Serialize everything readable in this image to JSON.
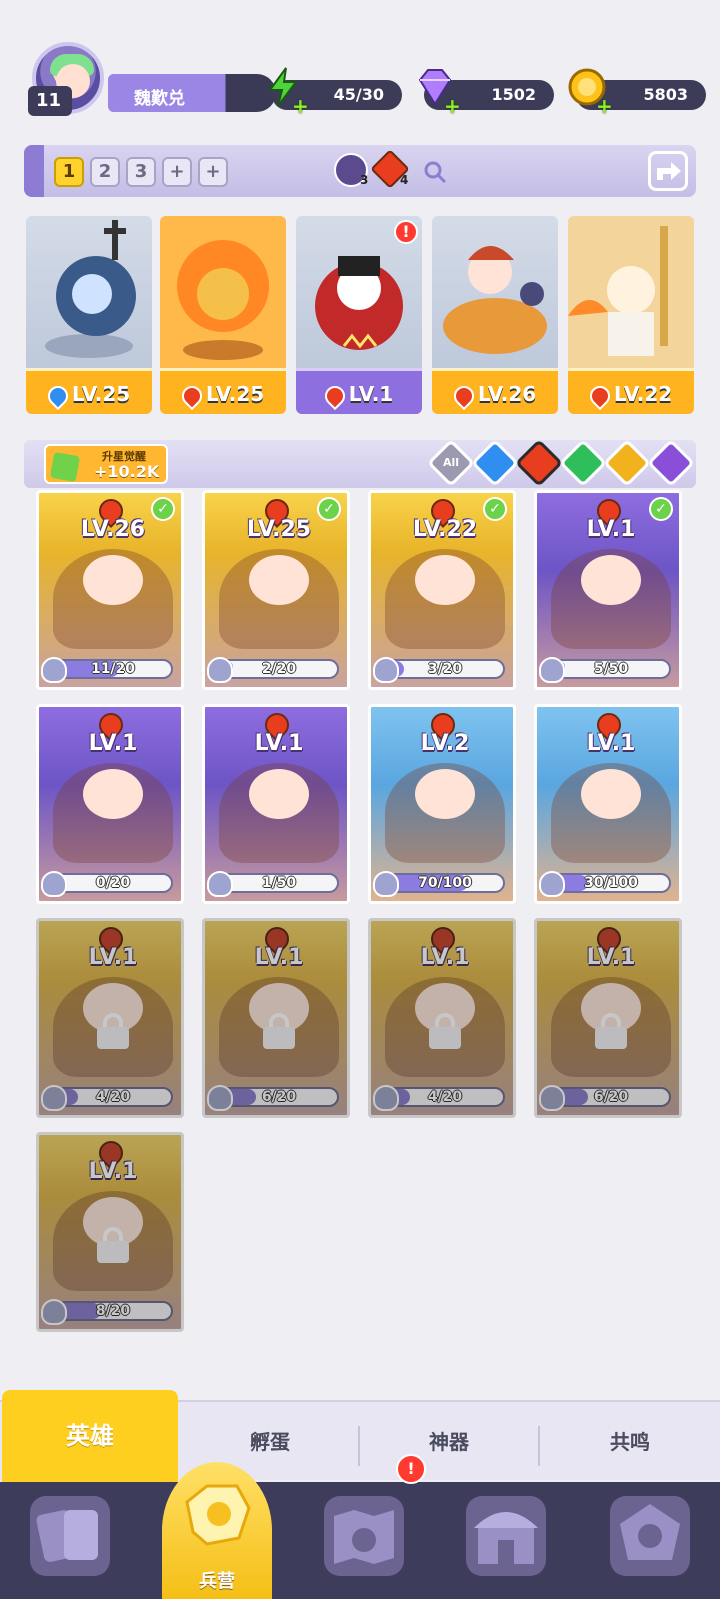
{
  "profile": {
    "level": "11",
    "name": "魏歎兑"
  },
  "resources": {
    "energy": "45/30",
    "gems": "1502",
    "coins": "5803"
  },
  "team": {
    "slots": [
      "1",
      "2",
      "3",
      "+",
      "+"
    ],
    "active_slot": "1",
    "counts": {
      "dark": "3",
      "fire": "4"
    },
    "members": [
      {
        "level": "LV.25",
        "element": "water"
      },
      {
        "level": "LV.25",
        "element": "fire"
      },
      {
        "level": "LV.1",
        "element": "fire",
        "alert": "!"
      },
      {
        "level": "LV.26",
        "element": "fire"
      },
      {
        "level": "LV.22",
        "element": "fire"
      }
    ]
  },
  "filter": {
    "upstar_label": "升星觉醒",
    "upstar_value": "+10.2K",
    "options": [
      "All",
      "water",
      "fire",
      "wind",
      "light",
      "dark"
    ]
  },
  "heroes": [
    {
      "level": "LV.26",
      "progress": "11/20",
      "ratio": 0.55,
      "style": "gold",
      "checked": true,
      "locked": false
    },
    {
      "level": "LV.25",
      "progress": "2/20",
      "ratio": 0.1,
      "style": "gold",
      "checked": true,
      "locked": false
    },
    {
      "level": "LV.22",
      "progress": "3/20",
      "ratio": 0.15,
      "style": "gold",
      "checked": true,
      "locked": false
    },
    {
      "level": "LV.1",
      "progress": "5/50",
      "ratio": 0.1,
      "style": "purple",
      "checked": true,
      "locked": false
    },
    {
      "level": "LV.1",
      "progress": "0/20",
      "ratio": 0,
      "style": "purple",
      "checked": false,
      "locked": false
    },
    {
      "level": "LV.1",
      "progress": "1/50",
      "ratio": 0.02,
      "style": "purple",
      "checked": false,
      "locked": false
    },
    {
      "level": "LV.2",
      "progress": "70/100",
      "ratio": 0.7,
      "style": "blue",
      "checked": false,
      "locked": false
    },
    {
      "level": "LV.1",
      "progress": "30/100",
      "ratio": 0.3,
      "style": "blue",
      "checked": false,
      "locked": false
    },
    {
      "level": "LV.1",
      "progress": "4/20",
      "ratio": 0.2,
      "style": "gold",
      "checked": false,
      "locked": true
    },
    {
      "level": "LV.1",
      "progress": "6/20",
      "ratio": 0.3,
      "style": "gold",
      "checked": false,
      "locked": true
    },
    {
      "level": "LV.1",
      "progress": "4/20",
      "ratio": 0.2,
      "style": "gold",
      "checked": false,
      "locked": true
    },
    {
      "level": "LV.1",
      "progress": "6/20",
      "ratio": 0.3,
      "style": "gold",
      "checked": false,
      "locked": true
    },
    {
      "level": "LV.1",
      "progress": "8/20",
      "ratio": 0.4,
      "style": "gold",
      "checked": false,
      "locked": true
    }
  ],
  "subtabs": [
    "英雄",
    "孵蛋",
    "神器",
    "共鸣"
  ],
  "nav": {
    "active_label": "兵营",
    "alert": "!"
  },
  "colors": {
    "accent": "#ffcf1f",
    "purple": "#8d6fe0",
    "navbar": "#3d3c5a"
  }
}
